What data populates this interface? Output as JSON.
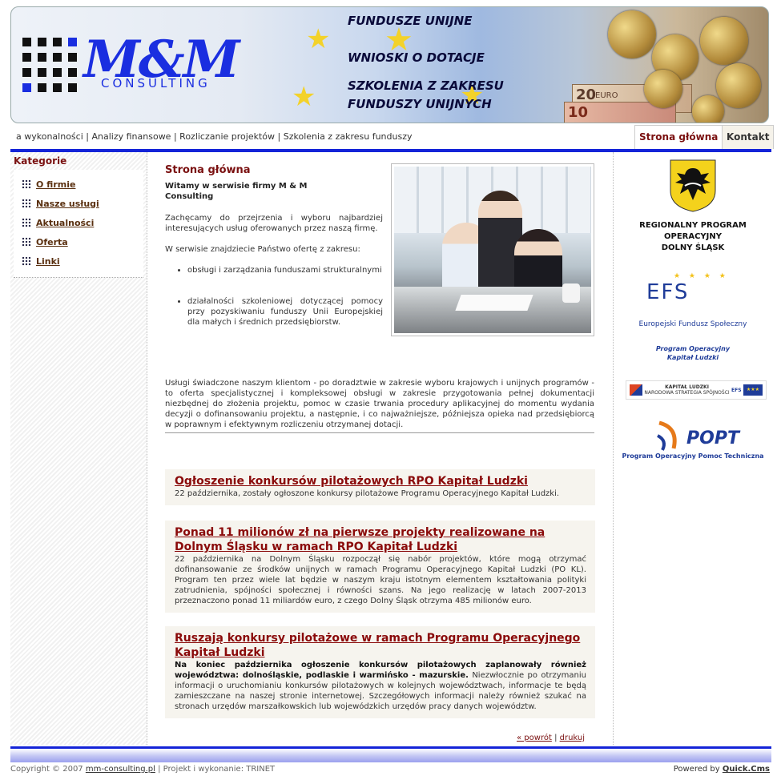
{
  "header": {
    "logo_text": "M&M",
    "logo_sub": "CONSULTING",
    "banner_lines": [
      "FUNDUSZE UNIJNE",
      "WNIOSKI O DOTACJE",
      "SZKOLENIA Z ZAKRESU",
      "FUNDUSZY UNIJNYCH"
    ],
    "note_label": "EURO",
    "note_values": [
      "20",
      "10"
    ]
  },
  "topnav": {
    "links": [
      "a wykonalności",
      "Analizy finansowe",
      "Rozliczanie projektów",
      "Szkolenia z zakresu funduszy"
    ],
    "separator": "|",
    "tabs": [
      "Strona główna",
      "Kontakt"
    ]
  },
  "sidebar": {
    "title": "Kategorie",
    "items": [
      "O firmie",
      "Nasze usługi",
      "Aktualności",
      "Oferta",
      "Linki"
    ]
  },
  "main": {
    "title": "Strona główna",
    "welcome": "Witamy w serwisie firmy M & M Consulting",
    "intro1": "Zachęcamy do przejrzenia i wyboru najbardziej interesujących usług oferowanych przez naszą firmę.",
    "intro2": "W serwisie znajdziecie Państwo ofertę z zakresu:",
    "bullets": [
      "obsługi i zarządzania funduszami strukturalnymi",
      "działalności szkoleniowej dotyczącej pomocy przy pozyskiwaniu funduszy Unii Europejskiej dla małych i średnich przedsiębiorstw."
    ],
    "description": "Usługi świadczone naszym klientom - po doradztwie w zakresie wyboru krajowych i unijnych programów - to oferta specjalistycznej i kompleksowej obsługi w zakresie przygotowania pełnej dokumentacji niezbędnej do złożenia projektu, pomoc w czasie trwania procedury aplikacyjnej do momentu wydania decyzji o dofinansowaniu projektu, a następnie, i co najważniejsze, późniejsza opieka nad przedsiębiorcą w poprawnym i efektywnym rozliczeniu otrzymanej dotacji."
  },
  "news": [
    {
      "title": "Ogłoszenie konkursów pilotażowych RPO Kapitał Ludzki",
      "body": "22 października, zostały ogłoszone konkursy pilotażowe Programu Operacyjnego Kapitał Ludzki."
    },
    {
      "title": "Ponad 11 milionów zł na pierwsze projekty realizowane na Dolnym Śląsku w ramach RPO Kapitał Ludzki",
      "body": "22 października na Dolnym Śląsku rozpoczął się nabór projektów, które mogą otrzymać dofinansowanie ze środków unijnych w ramach Programu Operacyjnego Kapitał Ludzki (PO KL). Program ten przez wiele lat będzie w naszym kraju istotnym elementem kształtowania polityki zatrudnienia, spójności społecznej i równości szans. Na jego realizację w latach 2007-2013 przeznaczono ponad 11 miliardów euro, z czego Dolny Śląsk otrzyma 485 milionów euro."
    },
    {
      "title": "Ruszają konkursy pilotażowe w ramach Programu Operacyjnego Kapitał Ludzki",
      "body_bold": "Na koniec października ogłoszenie konkursów pilotażowych zaplanowały również województwa: dolnośląskie, podlaskie i warmińsko - mazurskie.",
      "body": "Niezwłocznie po otrzymaniu informacji o uruchomianiu konkursów pilotażowych w kolejnych województwach, informacje te będą zamieszczane na naszej stronie internetowej. Szczegółowych informacji należy również szukać na stronach urzędów marszałkowskich lub wojewódzkich urzędów pracy danych województw."
    }
  ],
  "bottom_links": {
    "back": "« powrót",
    "separator": "|",
    "print": "drukuj"
  },
  "right": {
    "rpo": [
      "REGIONALNY PROGRAM",
      "OPERACYJNY",
      "DOLNY ŚLĄSK"
    ],
    "efs": "EFS",
    "efs_sub": "Europejski Fundusz Społeczny",
    "efs_prog": [
      "Program Operacyjny",
      "Kapitał Ludzki"
    ],
    "kl_text": "KAPITAŁ LUDZKI",
    "kl_sub": "NARODOWA STRATEGIA SPÓJNOŚCI",
    "kl_efs": "EFS",
    "popt": "POPT",
    "popt_sub": "Program Operacyjny Pomoc Techniczna"
  },
  "footer": {
    "copyright_prefix": "Copyright © 2007",
    "site": "mm-consulting.pl",
    "sep": "|",
    "credit": "Projekt i wykonanie: TRINET",
    "powered_prefix": "Powered by",
    "powered_link": "Quick.Cms"
  },
  "colors": {
    "accent": "#7a1010",
    "bar": "#1424d8",
    "logo": "#1a2ee0"
  }
}
